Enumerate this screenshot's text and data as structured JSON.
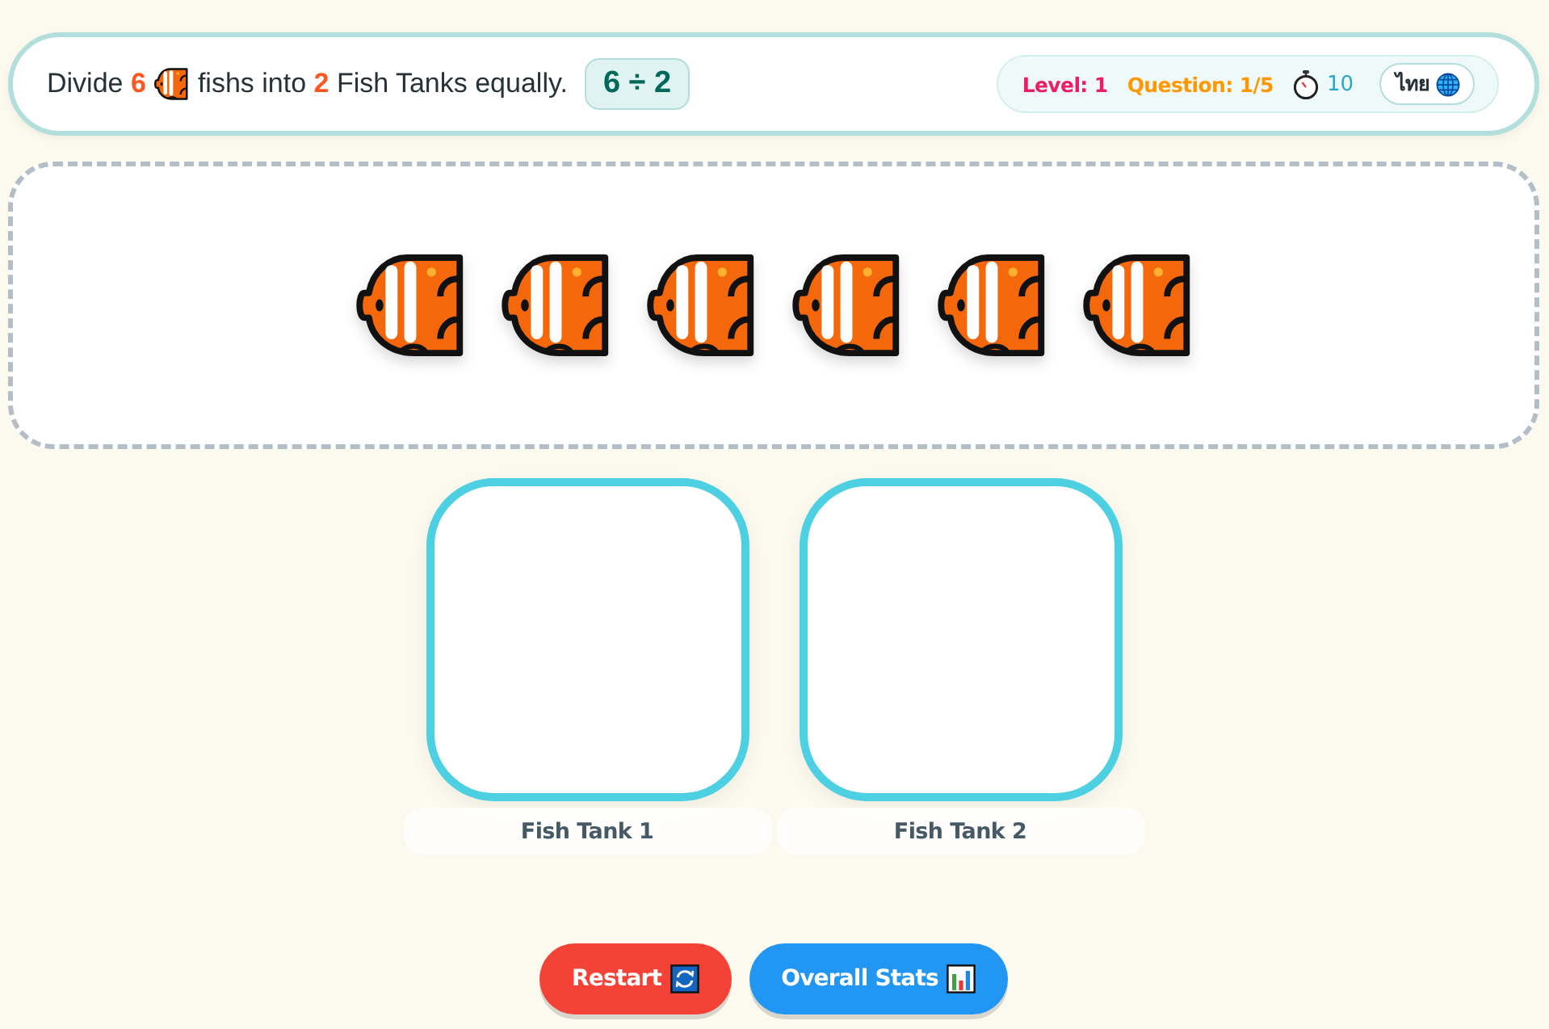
{
  "question": {
    "text_before": "Divide **6**",
    "text_after": "fishs into **2** Fish Tanks equally.",
    "expression": "6 ÷ 2"
  },
  "stats": {
    "level": "Level: 1",
    "question": "Question: 1/5",
    "timer": "10",
    "language": "ไทย"
  },
  "pool": {
    "items": [
      {
        "kind": "fish"
      },
      {
        "kind": "fish"
      },
      {
        "kind": "fish"
      },
      {
        "kind": "fish"
      },
      {
        "kind": "fish"
      },
      {
        "kind": "fish"
      }
    ]
  },
  "tanks": [
    {
      "label": "Fish Tank 1"
    },
    {
      "label": "Fish Tank 2"
    }
  ],
  "buttons": [
    {
      "kind": "restart",
      "label": "Restart"
    },
    {
      "kind": "stats",
      "label": "Overall Stats"
    }
  ]
}
